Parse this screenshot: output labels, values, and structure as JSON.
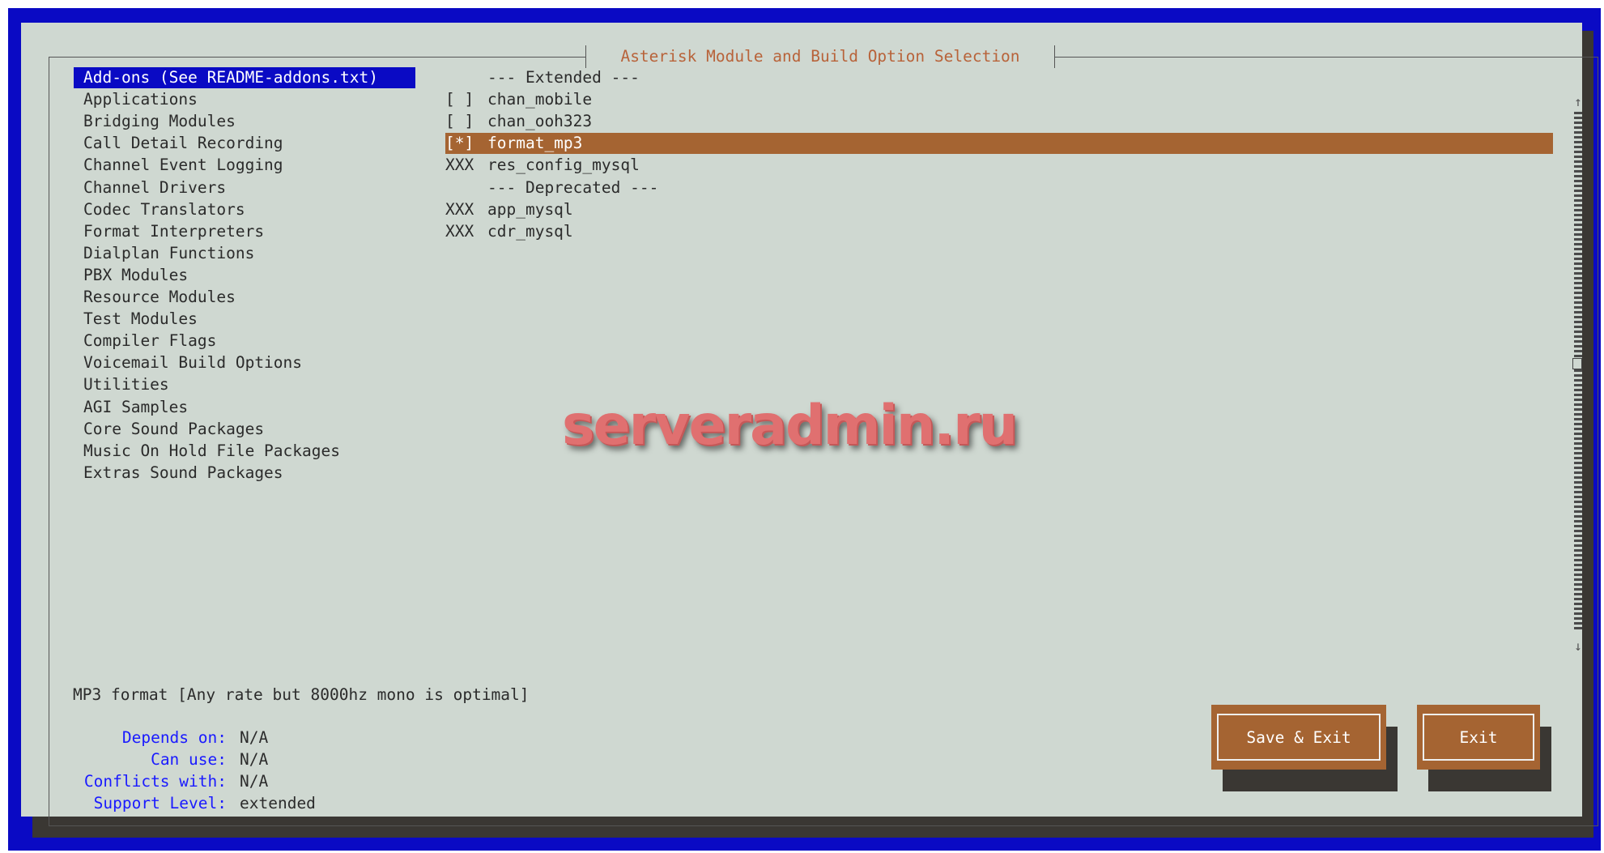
{
  "title": "Asterisk Module and Build Option Selection",
  "categories": [
    "Add-ons (See README-addons.txt)",
    "Applications",
    "Bridging Modules",
    "Call Detail Recording",
    "Channel Event Logging",
    "Channel Drivers",
    "Codec Translators",
    "Format Interpreters",
    "Dialplan Functions",
    "PBX Modules",
    "Resource Modules",
    "Test Modules",
    "Compiler Flags",
    "Voicemail Build Options",
    "Utilities",
    "AGI Samples",
    "Core Sound Packages",
    "Music On Hold File Packages",
    "Extras Sound Packages"
  ],
  "selected_category": "Add-ons (See README-addons.txt)",
  "options": [
    {
      "marker": "",
      "label": "--- Extended ---"
    },
    {
      "marker": "[ ]",
      "label": "chan_mobile"
    },
    {
      "marker": "[ ]",
      "label": "chan_ooh323"
    },
    {
      "marker": "[*]",
      "label": "format_mp3"
    },
    {
      "marker": "XXX",
      "label": "res_config_mysql"
    },
    {
      "marker": "",
      "label": "--- Deprecated ---"
    },
    {
      "marker": "XXX",
      "label": "app_mysql"
    },
    {
      "marker": "XXX",
      "label": "cdr_mysql"
    }
  ],
  "highlighted_option": "format_mp3",
  "scrollbar": {
    "up_arrow": "↑",
    "down_arrow": "↓"
  },
  "description": "MP3 format [Any rate but 8000hz mono is optimal]",
  "info": {
    "depends_on_label": "Depends on:",
    "depends_on": "N/A",
    "can_use_label": "Can use:",
    "can_use": "N/A",
    "conflicts_with_label": "Conflicts with:",
    "conflicts_with": "N/A",
    "support_level_label": "Support Level:",
    "support_level": "extended"
  },
  "buttons": {
    "save_exit": "Save & Exit",
    "exit": "Exit"
  },
  "watermark": "serveradmin.ru",
  "colors": {
    "screen_blue": "#0a0ac4",
    "dialog_bg": "#cfd8d1",
    "highlight": "#a56432",
    "title_text": "#b8633a",
    "label_blue": "#1a1aff"
  }
}
